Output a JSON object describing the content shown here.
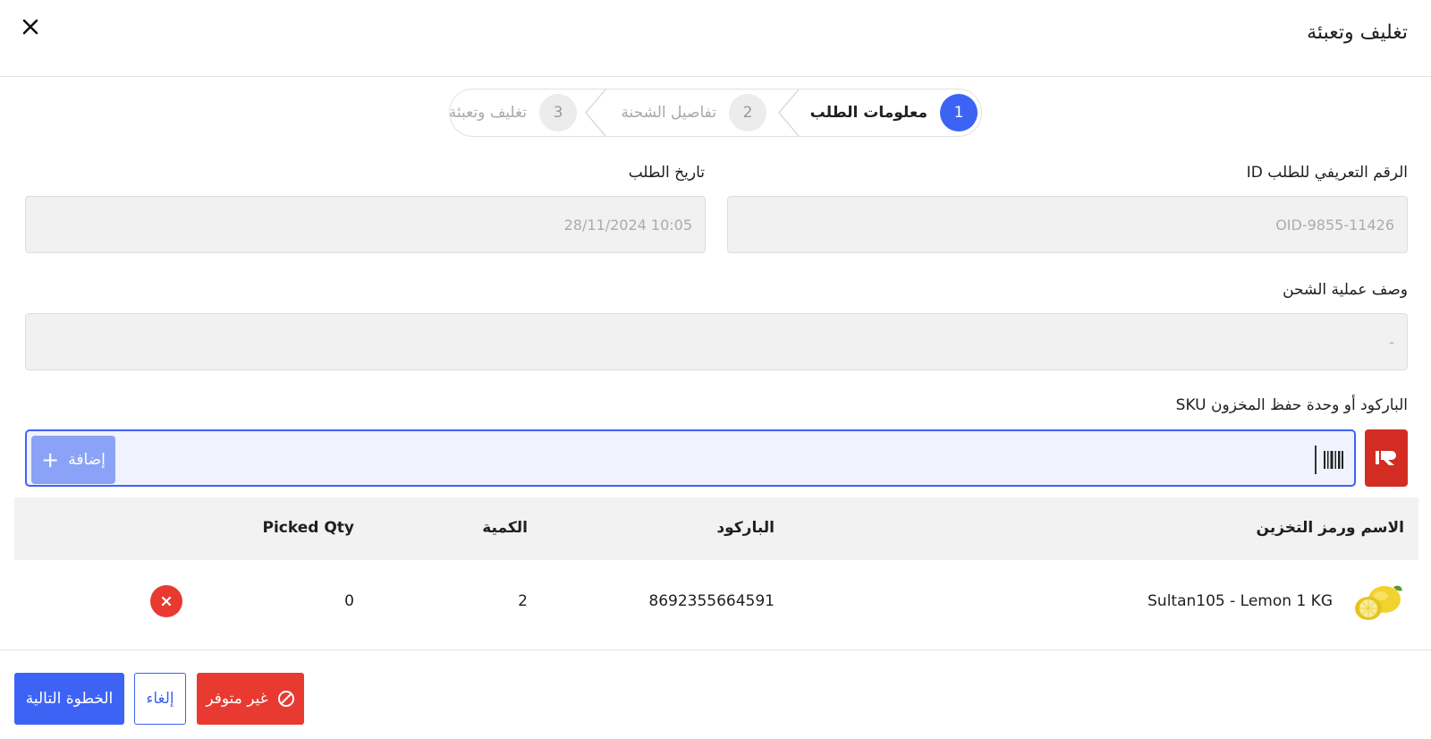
{
  "modal": {
    "title": "تغليف وتعبئة"
  },
  "stepper": {
    "steps": [
      {
        "number": "1",
        "label": "معلومات الطلب",
        "state": "active"
      },
      {
        "number": "2",
        "label": "تفاصيل الشحنة",
        "state": "inactive"
      },
      {
        "number": "3",
        "label": "تغليف وتعبئة",
        "state": "inactive"
      }
    ]
  },
  "form": {
    "order_id_label": "الرقم التعريفي للطلب ID",
    "order_id_value": "OID-9855-11426",
    "order_date_label": "تاريخ الطلب",
    "order_date_value": "10:05 28/11/2024",
    "shipping_desc_label": "وصف عملية الشحن",
    "shipping_desc_value": "-",
    "barcode_label": "الباركود أو وحدة حفظ المخزون SKU",
    "add_label": "إضافة"
  },
  "table": {
    "headers": {
      "name_sku": "الاسم ورمز التخزين",
      "barcode": "الباركود",
      "quantity": "الكمية",
      "picked_qty": "Picked Qty"
    },
    "rows": [
      {
        "name": "Sultan105 - Lemon 1 KG",
        "barcode": "8692355664591",
        "quantity": "2",
        "picked_qty": "0"
      }
    ]
  },
  "footer": {
    "next_label": "الخطوة التالية",
    "cancel_label": "إلغاء",
    "unavailable_label": "غير متوفر"
  },
  "colors": {
    "primary": "#3d63f5",
    "danger": "#e83a30",
    "brand": "#d32c22"
  },
  "icons": {
    "close": "close-icon",
    "add": "plus-icon",
    "barcode": "barcode-icon",
    "brand": "brand-logo-icon",
    "remove": "close-circle-icon",
    "unavailable": "ban-icon"
  }
}
